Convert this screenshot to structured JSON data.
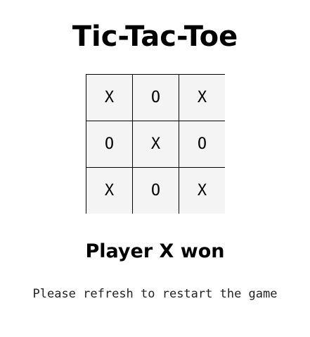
{
  "title": "Tic-Tac-Toe",
  "board": {
    "cells": [
      "X",
      "O",
      "X",
      "O",
      "X",
      "O",
      "X",
      "O",
      "X"
    ]
  },
  "status": "Player X won",
  "hint": "Please refresh to restart the game",
  "colors": {
    "cell_background": "#f4f4f4",
    "grid_line": "#000000",
    "text": "#000000"
  }
}
